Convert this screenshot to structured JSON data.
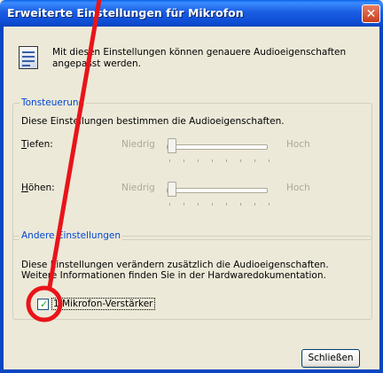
{
  "window": {
    "title": "Erweiterte Einstellungen für Mikrofon",
    "close_symbol": "✕"
  },
  "info": {
    "text": "Mit diesen Einstellungen können genauere Audioeigenschaften angepasst werden.",
    "icon": "settings-document-icon"
  },
  "tone": {
    "legend": "Tonsteuerung",
    "description": "Diese Einstellungen bestimmen die Audioeigenschaften.",
    "bass": {
      "label_u": "T",
      "label_rest": "iefen:",
      "low": "Niedrig",
      "high": "Hoch",
      "level": 0.0
    },
    "treble": {
      "label_u": "H",
      "label_rest": "öhen:",
      "low": "Niedrig",
      "high": "Hoch",
      "level": 0.0
    }
  },
  "other": {
    "legend": "Andere Einstellungen",
    "line1": "Diese Einstellungen verändern zusätzlich die Audioeigenschaften.",
    "line2": "Weitere Informationen finden Sie in der Hardwaredokumentation.",
    "checkbox_label": "1 Mikrofon-Verstärker",
    "checkbox_checked": true
  },
  "buttons": {
    "close": "Schließen"
  },
  "annotation": {
    "color": "#e8141a"
  }
}
